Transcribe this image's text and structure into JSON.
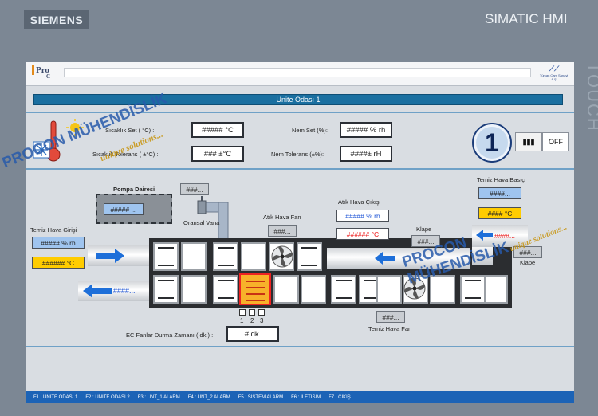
{
  "device": {
    "brand": "SIEMENS",
    "model": "SIMATIC HMI",
    "panel_text": "TOUCH"
  },
  "header": {
    "logo_text": "Pro",
    "logo_sub": "C",
    "company_text": "Türkan Cam Sanayii A.Ş."
  },
  "title": "Unite Odası 1",
  "settings": {
    "temp_set_label": "Sıcaklık Set ( °C) :",
    "temp_set_value": "##### °C",
    "temp_tol_label": "Sıcaklık Tolerans ( ±°C) :",
    "temp_tol_value": "### ±°C",
    "hum_set_label": "Nem Set (%):",
    "hum_set_value": "##### % rh",
    "hum_tol_label": "Nem Tolerans (±%):",
    "hum_tol_value": "####± rH"
  },
  "unit_control": {
    "number": "1",
    "on_label": "I",
    "off_label": "OFF"
  },
  "diagram": {
    "pompa_label": "Pompa Dairesi",
    "pompa_value": "##### ...",
    "valve_value": "###...",
    "valve_label": "Oransal Vana",
    "supply_in_label": "Temiz Hava Girişi",
    "supply_in_hum": "##### % rh",
    "supply_in_temp": "###### °C",
    "exhaust_fan_label": "Atık Hava Fan",
    "exhaust_fan_value": "###...",
    "exhaust_out_label": "Atık Hava Çıkışı",
    "exhaust_out_hum": "##### % rh",
    "exhaust_out_temp": "###### °C",
    "clean_pressure_label": "Temiz Hava Basıç",
    "clean_pressure_value": "####...",
    "clean_pressure_temp": "#### °C",
    "damper_top_label": "Klape",
    "damper_top_value": "###...",
    "damper_right_value": "###...",
    "damper_right_label": "Klape",
    "return_value": "####...",
    "right_return_value": "####...",
    "supply_fan_value": "###...",
    "supply_fan_label": "Temiz Hava Fan",
    "coil_steps": [
      "1",
      "2",
      "3"
    ],
    "ec_label": "EC Fanlar Durma Zamanı ( dk.) :",
    "ec_value": "# dk."
  },
  "fkeys": [
    "F1 : UNITE ODASI 1",
    "F2 : UNITE ODASI 2",
    "F3 : UNT_1 ALARM",
    "F4 : UNT_2 ALARM",
    "F5 : SISTEM ALARM",
    "F6 : ILETISIM",
    "F7 : ÇIKIŞ"
  ],
  "watermarks": {
    "brand": "PROCON MÜHENDİSLİK",
    "tagline": "unique solutions..."
  },
  "colors": {
    "title_band": "#1a6fa0",
    "fkey_bar": "#1c63b6",
    "coil": "#f7b12a",
    "temp_box": "#ffcc00",
    "hum_box": "#9fc4ef",
    "arrow_blue": "#1e6fd9"
  }
}
